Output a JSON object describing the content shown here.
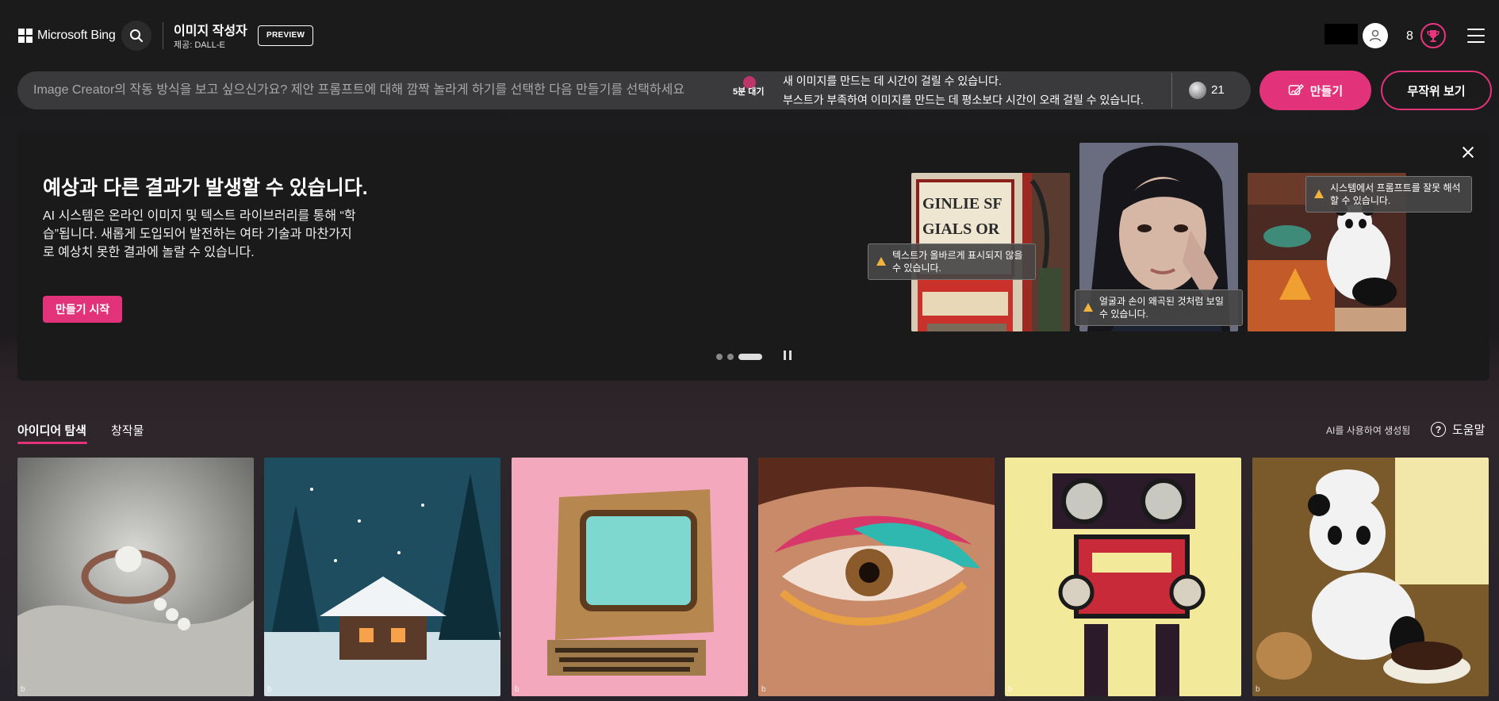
{
  "header": {
    "brand": "Microsoft Bing",
    "app_title": "이미지 작성자",
    "app_subtitle": "제공: DALL-E",
    "preview_badge": "PREVIEW",
    "reward_count": "8"
  },
  "prompt": {
    "placeholder": "Image Creator의 작동 방식을 보고 싶으신가요? 제안 프롬프트에 대해 깜짝 놀라게 하기를 선택한 다음 만들기를 선택하세요",
    "wait_label": "5분 대기",
    "notice_line1": "새 이미지를 만드는 데 시간이 걸릴 수 있습니다.",
    "notice_line2": "부스트가 부족하여 이미지를 만드는 데 평소보다 시간이 오래 걸릴 수 있습니다.",
    "boost_count": "21",
    "create_label": "만들기",
    "random_label": "무작위 보기"
  },
  "hero": {
    "title": "예상과 다른 결과가 발생할 수 있습니다.",
    "body": "AI 시스템은 온라인 이미지 및 텍스트 라이브러리를 통해 “학습”됩니다. 새롭게 도입되어 발전하는 여타 기술과 마찬가지로 예상치 못한 결과에 놀랄 수 있습니다.",
    "cta": "만들기 시작",
    "warnings": {
      "text": "텍스트가 올바르게 표시되지 않을 수 있습니다.",
      "face": "얼굴과 손이 왜곡된 것처럼 보일 수 있습니다.",
      "prompt": "시스템에서 프롬프트를 잘못 해석할 수 있습니다."
    },
    "sign_text": [
      "GINLIE SF",
      "GIALS OR"
    ],
    "carousel": {
      "slides": 3,
      "active": 3
    }
  },
  "tabs": {
    "explore": "아이디어 탐색",
    "creations": "창작물"
  },
  "ai_label": "AI를 사용하여 생성됨",
  "help_label": "도움말",
  "gallery": {
    "mark": "b",
    "items": [
      "pearl-ring",
      "snowy-cabin",
      "retro-computer",
      "colorful-eye",
      "retro-robot",
      "panda-chef"
    ]
  },
  "colors": {
    "accent": "#e2327a",
    "background": "#1c1b1c",
    "card": "#1a1a1b"
  }
}
